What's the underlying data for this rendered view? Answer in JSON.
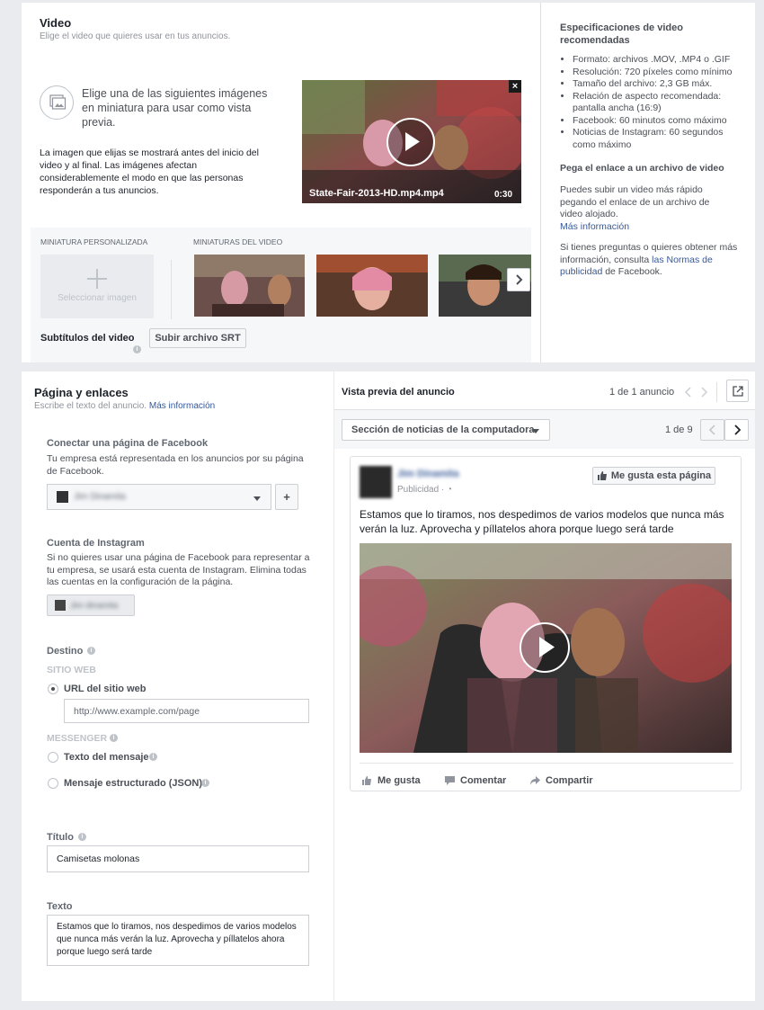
{
  "video_section": {
    "title": "Video",
    "subtitle": "Elige el video que quieres usar en tus anuncios.",
    "thumb_prompt": "Elige una de las siguientes imágenes en miniatura para usar como vista previa.",
    "thumb_desc": "La imagen que elijas se mostrará antes del inicio del video y al final. Las imágenes afectan considerablemente el modo en que las personas responderán a tus anuncios.",
    "video_filename": "State-Fair-2013-HD.mp4.mp4",
    "video_duration": "0:30",
    "custom_thumb_label": "MINIATURA PERSONALIZADA",
    "video_thumbs_label": "MINIATURAS DEL VIDEO",
    "select_image_label": "Seleccionar imagen",
    "subtitles_label": "Subtítulos del video",
    "upload_srt_label": "Subir archivo SRT"
  },
  "specs": {
    "title": "Especificaciones de video recomendadas",
    "items": [
      "Formato: archivos .MOV, .MP4 o .GIF",
      "Resolución: 720 píxeles como mínimo",
      "Tamaño del archivo: 2,3 GB máx.",
      "Relación de aspecto recomendada: pantalla ancha (16:9)",
      "Facebook: 60 minutos como máximo",
      "Noticias de Instagram: 60 segundos como máximo"
    ],
    "link_title": "Pega el enlace a un archivo de video",
    "link_desc": "Puedes subir un video más rápido pegando el enlace de un archivo de video alojado.",
    "more_info": "Más información",
    "questions_pre": "Si tienes preguntas o quieres obtener más información, consulta ",
    "policies_link": "las Normas de publicidad",
    "questions_post": " de Facebook."
  },
  "page_links": {
    "title": "Página y enlaces",
    "subtitle_pre": "Escribe el texto del anuncio. ",
    "more_info": "Más información",
    "connect_title": "Conectar una página de Facebook",
    "connect_desc": "Tu empresa está representada en los anuncios por su página de Facebook.",
    "page_name": "Jim Dinamita",
    "instagram_title": "Cuenta de Instagram",
    "instagram_desc": "Si no quieres usar una página de Facebook para representar a tu empresa, se usará esta cuenta de Instagram. Elimina todas las cuentas en la configuración de la página.",
    "instagram_name": "Jim dinamita",
    "destination_label": "Destino",
    "website_label": "SITIO WEB",
    "url_option": "URL del sitio web",
    "url_placeholder": "http://www.example.com/page",
    "messenger_label": "MESSENGER",
    "message_text_option": "Texto del mensaje",
    "structured_option": "Mensaje estructurado (JSON)",
    "title_label": "Título",
    "title_value": "Camisetas molonas",
    "text_label": "Texto",
    "text_value": "Estamos que lo tiramos, nos despedimos de varios modelos que nunca más verán la luz. Aprovecha y píllatelos ahora porque luego será tarde"
  },
  "preview": {
    "title": "Vista previa del anuncio",
    "count": "1 de 1 anuncio",
    "placement": "Sección de noticias de la computadora",
    "placement_count": "1 de 9",
    "page_name": "Jim Dinamita",
    "sponsored": "Publicidad · ",
    "like_page": "Me gusta esta página",
    "body_text": "Estamos que lo tiramos, nos despedimos de varios modelos que nunca más verán la luz. Aprovecha y píllatelos ahora porque luego será tarde",
    "like": "Me gusta",
    "comment": "Comentar",
    "share": "Compartir"
  },
  "colors": {
    "link": "#365899",
    "background": "#e9ebee"
  }
}
